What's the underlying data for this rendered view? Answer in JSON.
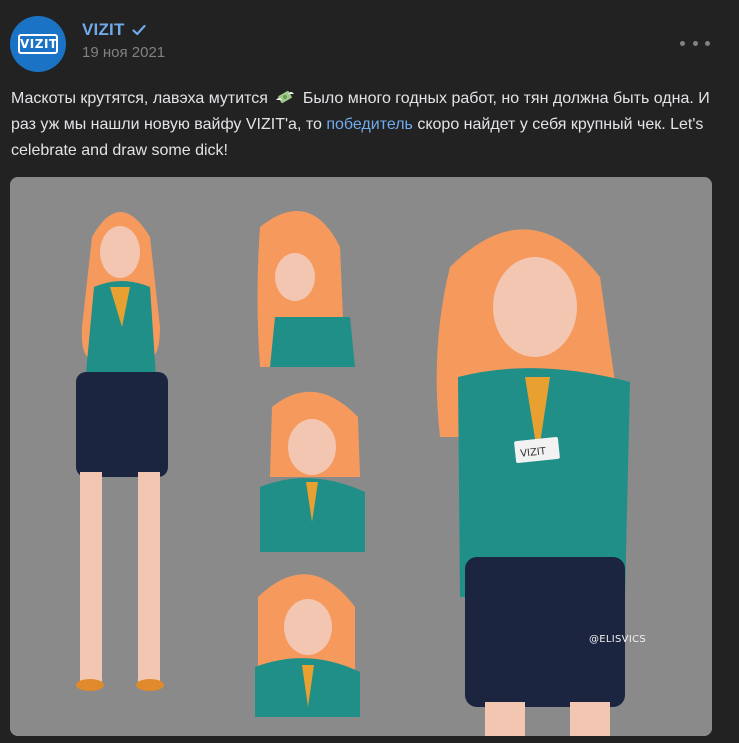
{
  "author": {
    "name": "VIZIT",
    "logo_text": "VIZIT",
    "date": "19 ноя 2021",
    "verified": true
  },
  "post": {
    "text_before_link": "Маскоты крутятся, лавэха мутится",
    "text_after_emoji": "Было много годных работ, но тян должна быть одна. И раз уж мы нашли новую вайфу VIZIT'a, то",
    "link_text": "победитель",
    "text_after_link": "скоро найдет у себя крупный чек. Let's celebrate and draw some dick!",
    "emoji": "money-with-wings-icon"
  },
  "image": {
    "badge_text": "VIZIT",
    "watermark": "@ELISVICS"
  },
  "colors": {
    "background": "#222222",
    "link": "#71aaeb",
    "accent": "#1b73c6",
    "image_bg": "#8a8a8a",
    "jacket": "#1f8f88",
    "hair": "#f59a5c"
  }
}
